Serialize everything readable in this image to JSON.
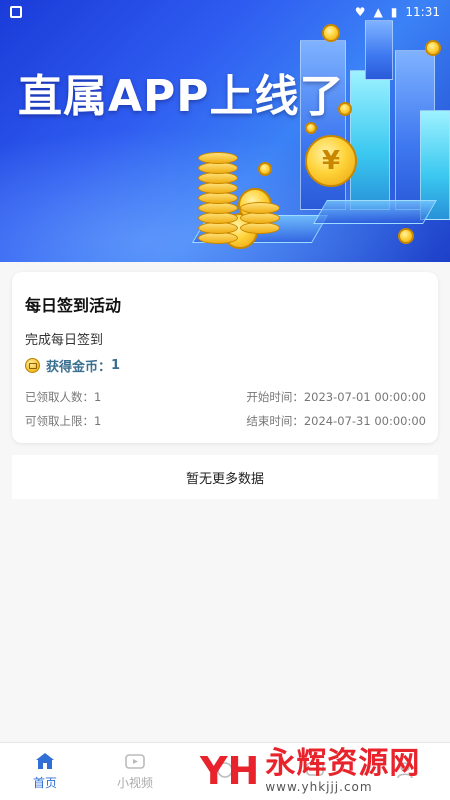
{
  "status_bar": {
    "time": "11:31"
  },
  "banner": {
    "title": "直属APP上线了",
    "coin_symbol": "¥"
  },
  "activity": {
    "title": "每日签到活动",
    "description": "完成每日签到",
    "reward_label": "获得金币：",
    "reward_value": "1",
    "claimed_label": "已领取人数：1",
    "limit_label": "可领取上限：1",
    "start_time": "开始时间：2023-07-01 00:00:00",
    "end_time": "结束时间：2024-07-31 00:00:00"
  },
  "no_more": "暂无更多数据",
  "tabbar": {
    "items": [
      {
        "label": "首页",
        "icon": "home-icon",
        "active": true
      },
      {
        "label": "小视频",
        "icon": "video-icon",
        "active": false
      },
      {
        "label": "",
        "icon": "coin-icon",
        "active": false
      },
      {
        "label": "",
        "icon": "message-icon",
        "active": false
      },
      {
        "label": "",
        "icon": "user-icon",
        "active": false
      }
    ]
  },
  "watermark": {
    "logo": "YH",
    "name": "永辉资源网",
    "url": "www.yhkjjj.com"
  },
  "colors": {
    "accent": "#2f6fd6",
    "banner": "#2f5cf0",
    "watermark": "#e8232b"
  }
}
